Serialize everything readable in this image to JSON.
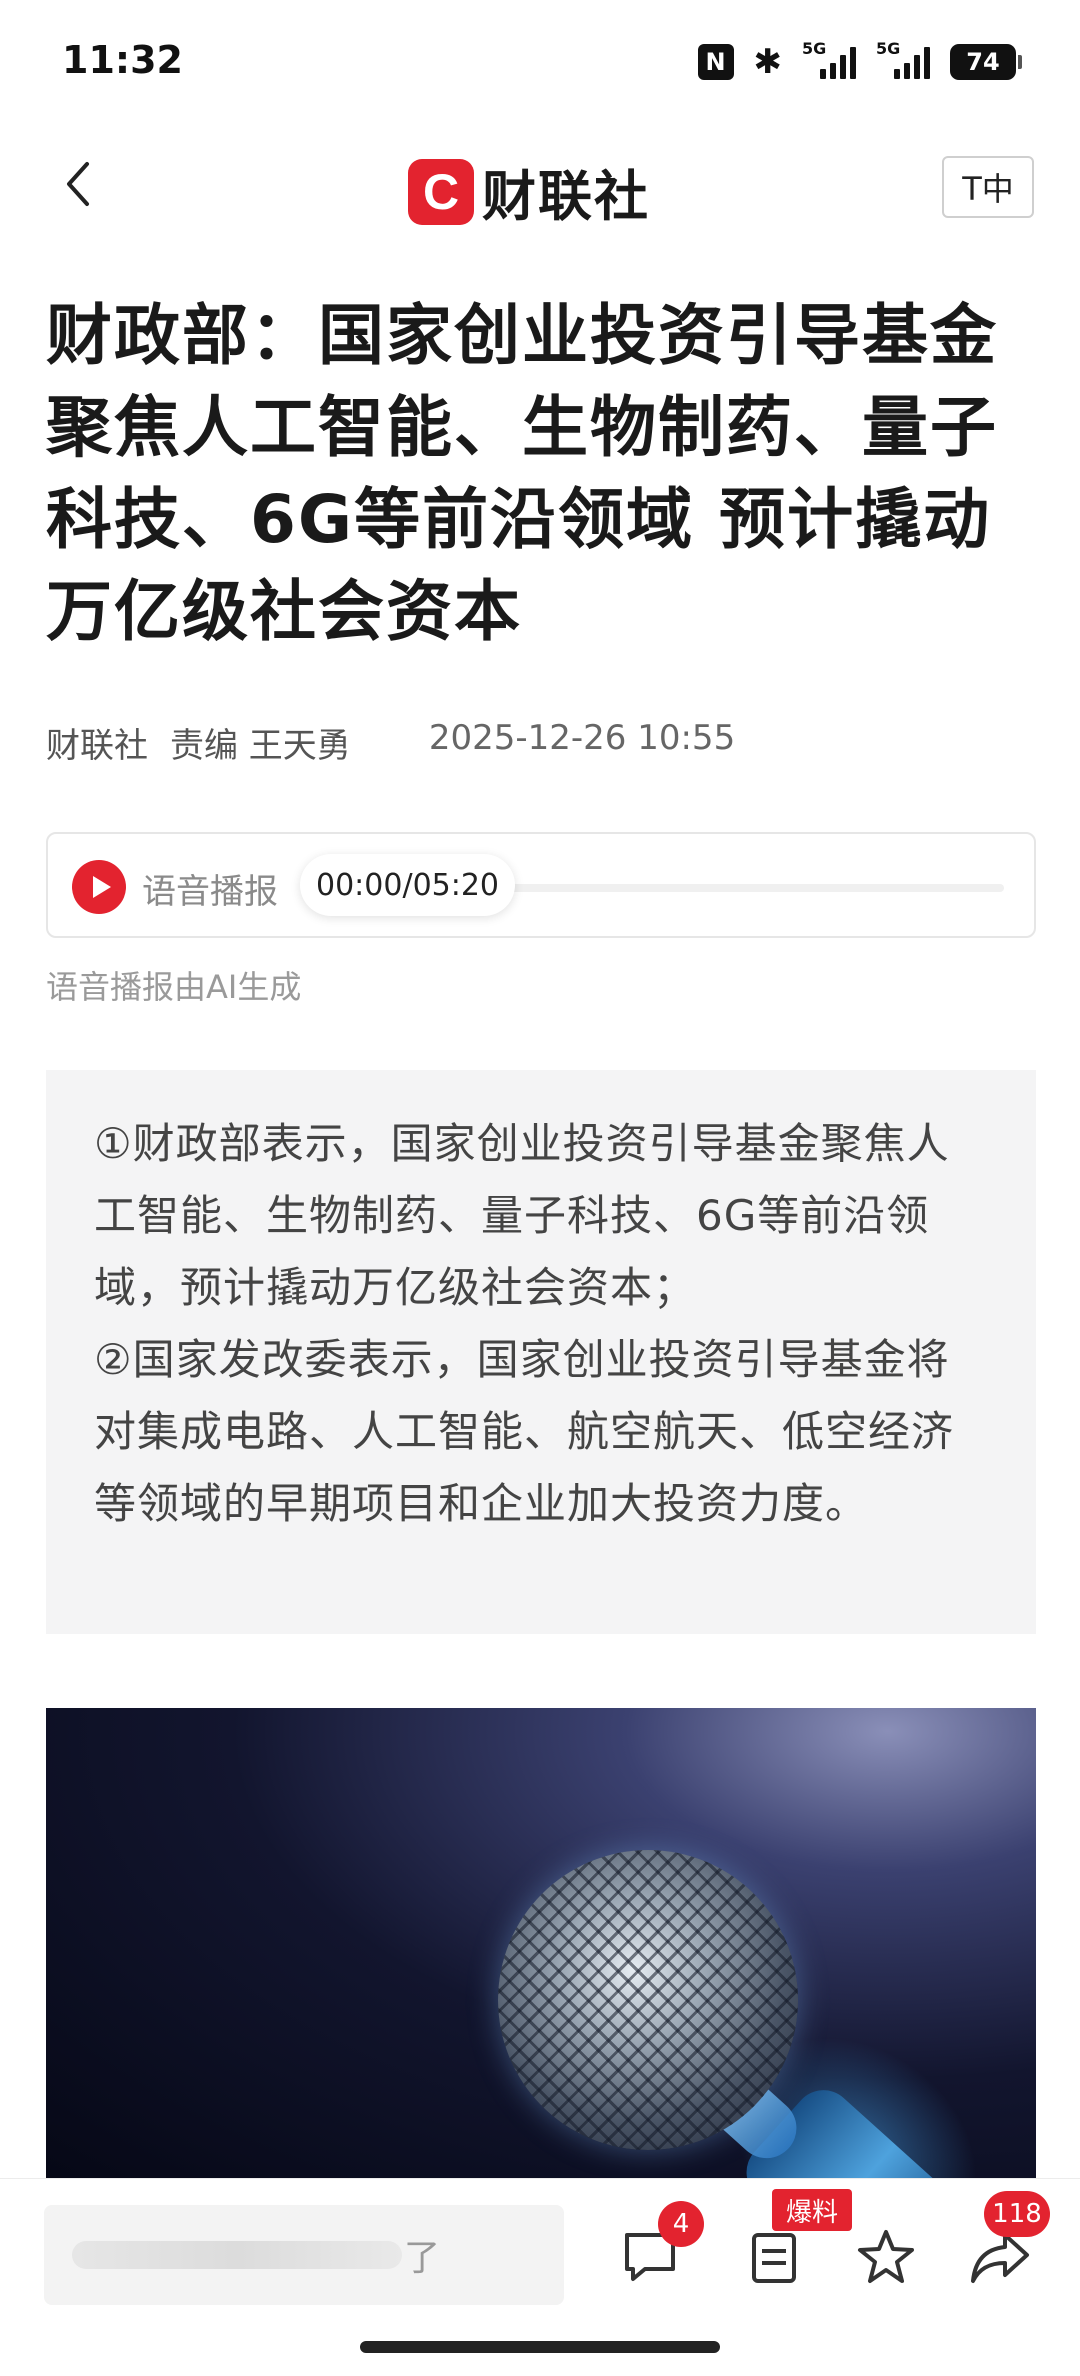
{
  "status_bar": {
    "time": "11:32",
    "nfc_label": "N",
    "network_1": "5G",
    "network_2": "5G",
    "battery": "74"
  },
  "nav": {
    "brand_mark": "C",
    "brand_name": "财联社",
    "font_button": "T中"
  },
  "article": {
    "title": "财政部：国家创业投资引导基金聚焦人工智能、生物制药、量子科技、6G等前沿领域 预计撬动万亿级社会资本",
    "source": "财联社",
    "editor": "责编 王天勇",
    "date": "2025-12-26 10:55",
    "audio_label": "语音播报",
    "audio_time": "00:00/05:20",
    "ai_note": "语音播报由AI生成",
    "summary": [
      "①财政部表示，国家创业投资引导基金聚焦人工智能、生物制药、量子科技、6G等前沿领域，预计撬动万亿级社会资本；",
      "②国家发改委表示，国家创业投资引导基金将对集成电路、人工智能、航空航天、低空经济等领域的早期项目和企业加大投资力度。"
    ]
  },
  "bottom_bar": {
    "comment_placeholder_tail": "了",
    "comment_count": "4",
    "report_label": "爆料",
    "share_count": "118"
  },
  "colors": {
    "accent": "#e3232f",
    "summary_bg": "#f4f4f5"
  },
  "icons": [
    "back-icon",
    "play-icon",
    "comment-icon",
    "report-icon",
    "star-icon",
    "share-icon"
  ]
}
